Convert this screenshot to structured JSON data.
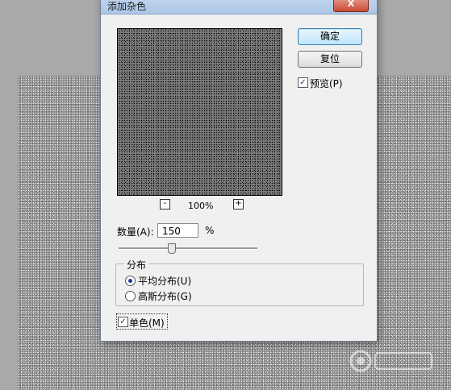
{
  "dialog": {
    "title": "添加杂色",
    "close_label": "X",
    "ok_label": "确定",
    "reset_label": "复位",
    "preview_label": "预览(P)",
    "preview_checked": true,
    "zoom_out_label": "-",
    "zoom_in_label": "+",
    "zoom_level": "100%",
    "amount_label": "数量(A):",
    "amount_value": "150",
    "amount_unit": "%",
    "amount_slider_fraction": 0.375,
    "distribution": {
      "title": "分布",
      "options": [
        {
          "label": "平均分布(U)",
          "selected": true
        },
        {
          "label": "高斯分布(G)",
          "selected": false
        }
      ]
    },
    "monochrome_label": "单色(M)",
    "monochrome_checked": true
  },
  "colors": {
    "dialog_bg": "#f0f0f0",
    "title_bar": "#b8cfea",
    "default_button": "#bee6fd"
  },
  "icons": {
    "close": "close-icon",
    "check": "check-icon",
    "radio": "radio-icon"
  }
}
